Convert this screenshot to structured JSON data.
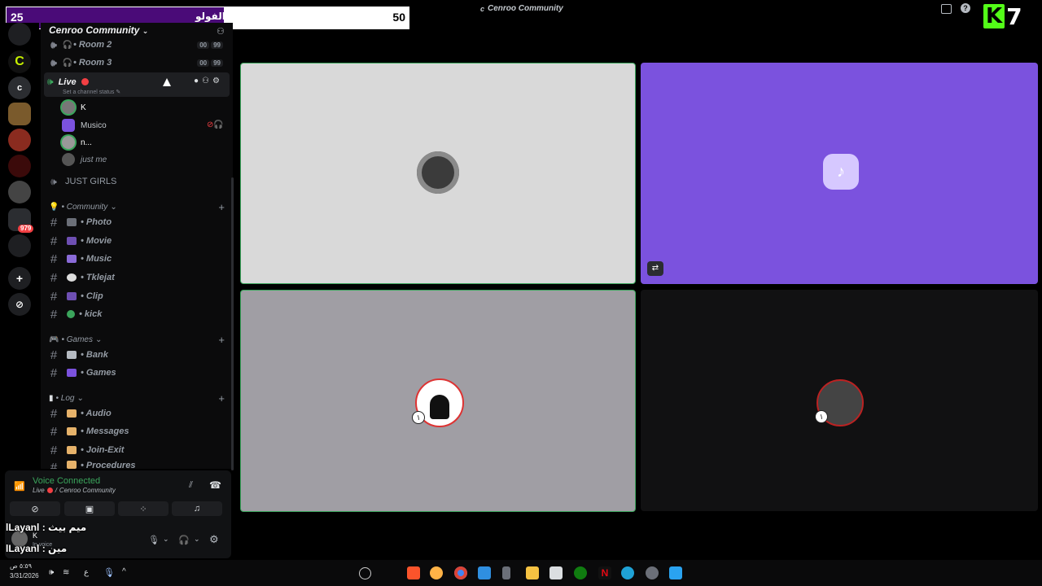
{
  "window": {
    "title": "Cenroo Community"
  },
  "banner": {
    "left_value": "25",
    "label": "الفولو",
    "right_value": "50",
    "progress": 0.54
  },
  "overlay_logo": {
    "letter": "K",
    "digit": "7"
  },
  "server": {
    "name": "Cenroo Community"
  },
  "voice_channels": [
    {
      "name": "• Room 2",
      "count_a": "00",
      "count_b": "99"
    },
    {
      "name": "• Room 3",
      "count_a": "00",
      "count_b": "99"
    }
  ],
  "live_channel": {
    "name": "Live",
    "status_hint": "Set a channel status"
  },
  "members": [
    "K",
    "Musico",
    "n...",
    "just me"
  ],
  "just_girls": "JUST GIRLS",
  "categories": [
    {
      "name": "• Community",
      "channels": [
        "• Photo",
        "• Movie",
        "• Music",
        "• Tklejat",
        "• Clip",
        "• kick"
      ]
    },
    {
      "name": "• Games",
      "channels": [
        "• Bank",
        "• Games"
      ]
    },
    {
      "name": "• Log",
      "channels": [
        "• Audio",
        "• Messages",
        "• Join-Exit",
        "• Procedures"
      ]
    }
  ],
  "rail": {
    "badge": "979"
  },
  "voice_status": {
    "title": "Voice Connected",
    "location": "Live",
    "server": "Cenroo Community"
  },
  "chat_overlay": [
    {
      "name": "lLayanl",
      "text": "ميم بيث"
    },
    {
      "name": "lLayanl",
      "text": "مين"
    }
  ],
  "user_panel": {
    "name": "K",
    "status": "In voice"
  },
  "clock": {
    "time": "٥:٥٩ ص",
    "date": "3/31/2026"
  },
  "taskbar_lang": "ع",
  "colors": {
    "speaking": "#3ba55c",
    "banner_fill": "#4a0b78",
    "tile_purple": "#7b52de",
    "tile_light": "#d9d9d9",
    "tile_gray": "#a09ea4",
    "tile_dark": "#111112"
  }
}
